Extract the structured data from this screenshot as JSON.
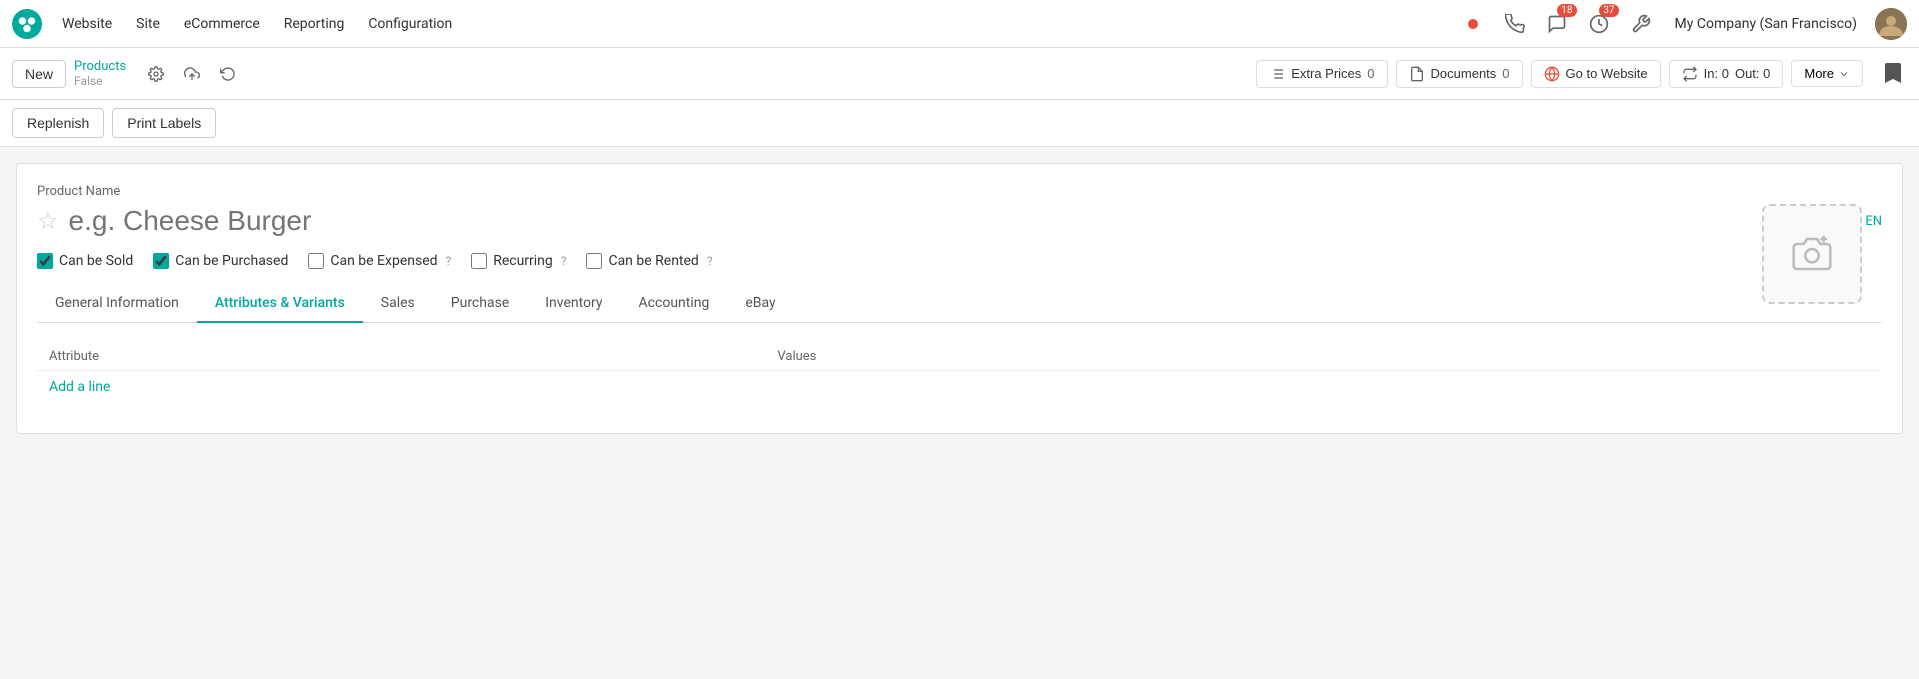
{
  "topnav": {
    "logo_alt": "Odoo",
    "items": [
      "Website",
      "Site",
      "eCommerce",
      "Reporting",
      "Configuration"
    ],
    "badge_messages": "18",
    "badge_clock": "37",
    "company": "My Company (San Francisco)"
  },
  "actionbar": {
    "new_label": "New",
    "breadcrumb_link": "Products",
    "breadcrumb_sub": "False",
    "extra_prices_label": "Extra Prices",
    "extra_prices_count": "0",
    "documents_label": "Documents",
    "documents_count": "0",
    "go_to_website_label": "Go to Website",
    "in_label": "In: 0",
    "out_label": "Out: 0",
    "more_label": "More"
  },
  "subactions": {
    "replenish_label": "Replenish",
    "print_labels_label": "Print Labels"
  },
  "form": {
    "product_name_label": "Product Name",
    "product_name_placeholder": "e.g. Cheese Burger",
    "lang": "EN",
    "checkboxes": [
      {
        "id": "cb_sold",
        "label": "Can be Sold",
        "checked": true,
        "has_help": false
      },
      {
        "id": "cb_purchased",
        "label": "Can be Purchased",
        "checked": true,
        "has_help": false
      },
      {
        "id": "cb_expensed",
        "label": "Can be Expensed",
        "checked": false,
        "has_help": true
      },
      {
        "id": "cb_recurring",
        "label": "Recurring",
        "checked": false,
        "has_help": true
      },
      {
        "id": "cb_rented",
        "label": "Can be Rented",
        "checked": false,
        "has_help": true
      }
    ],
    "tabs": [
      {
        "id": "general",
        "label": "General Information",
        "active": false
      },
      {
        "id": "attributes",
        "label": "Attributes & Variants",
        "active": true
      },
      {
        "id": "sales",
        "label": "Sales",
        "active": false
      },
      {
        "id": "purchase",
        "label": "Purchase",
        "active": false
      },
      {
        "id": "inventory",
        "label": "Inventory",
        "active": false
      },
      {
        "id": "accounting",
        "label": "Accounting",
        "active": false
      },
      {
        "id": "ebay",
        "label": "eBay",
        "active": false
      }
    ],
    "table_col_attribute": "Attribute",
    "table_col_values": "Values",
    "add_line_label": "Add a line"
  }
}
